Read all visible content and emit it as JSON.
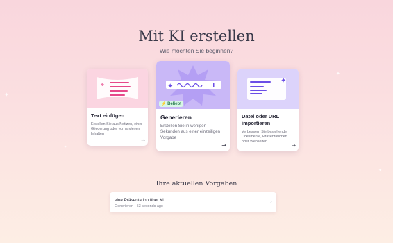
{
  "header": {
    "title": "Mit KI erstellen",
    "subtitle": "Wie möchten Sie beginnen?"
  },
  "cards": [
    {
      "title": "Text einfügen",
      "description": "Erstellen Sie aus Notizen, einer Gliederung oder vorhandenen Inhalten",
      "icon": "arrow-right-icon"
    },
    {
      "title": "Generieren",
      "description": "Erstellen Sie in wenigen Sekunden aus einer einzeiligen Vorgabe",
      "badge": "⚡ Beliebt",
      "icon": "arrow-right-icon"
    },
    {
      "title": "Datei oder URL importieren",
      "description": "Verbessern Sie bestehende Dokumente, Präsentationen oder Webseiten",
      "icon": "arrow-right-icon"
    }
  ],
  "recent": {
    "section_title": "Ihre aktuellen Vorgaben",
    "items": [
      {
        "title": "eine Präsentation über Ki",
        "meta": "Generieren · 53 seconds ago"
      }
    ]
  },
  "colors": {
    "pink_card": "#fbd5e1",
    "purple_card": "#c9b8f7",
    "lavender_card": "#dcd3fb",
    "accent": "#e6488a"
  }
}
